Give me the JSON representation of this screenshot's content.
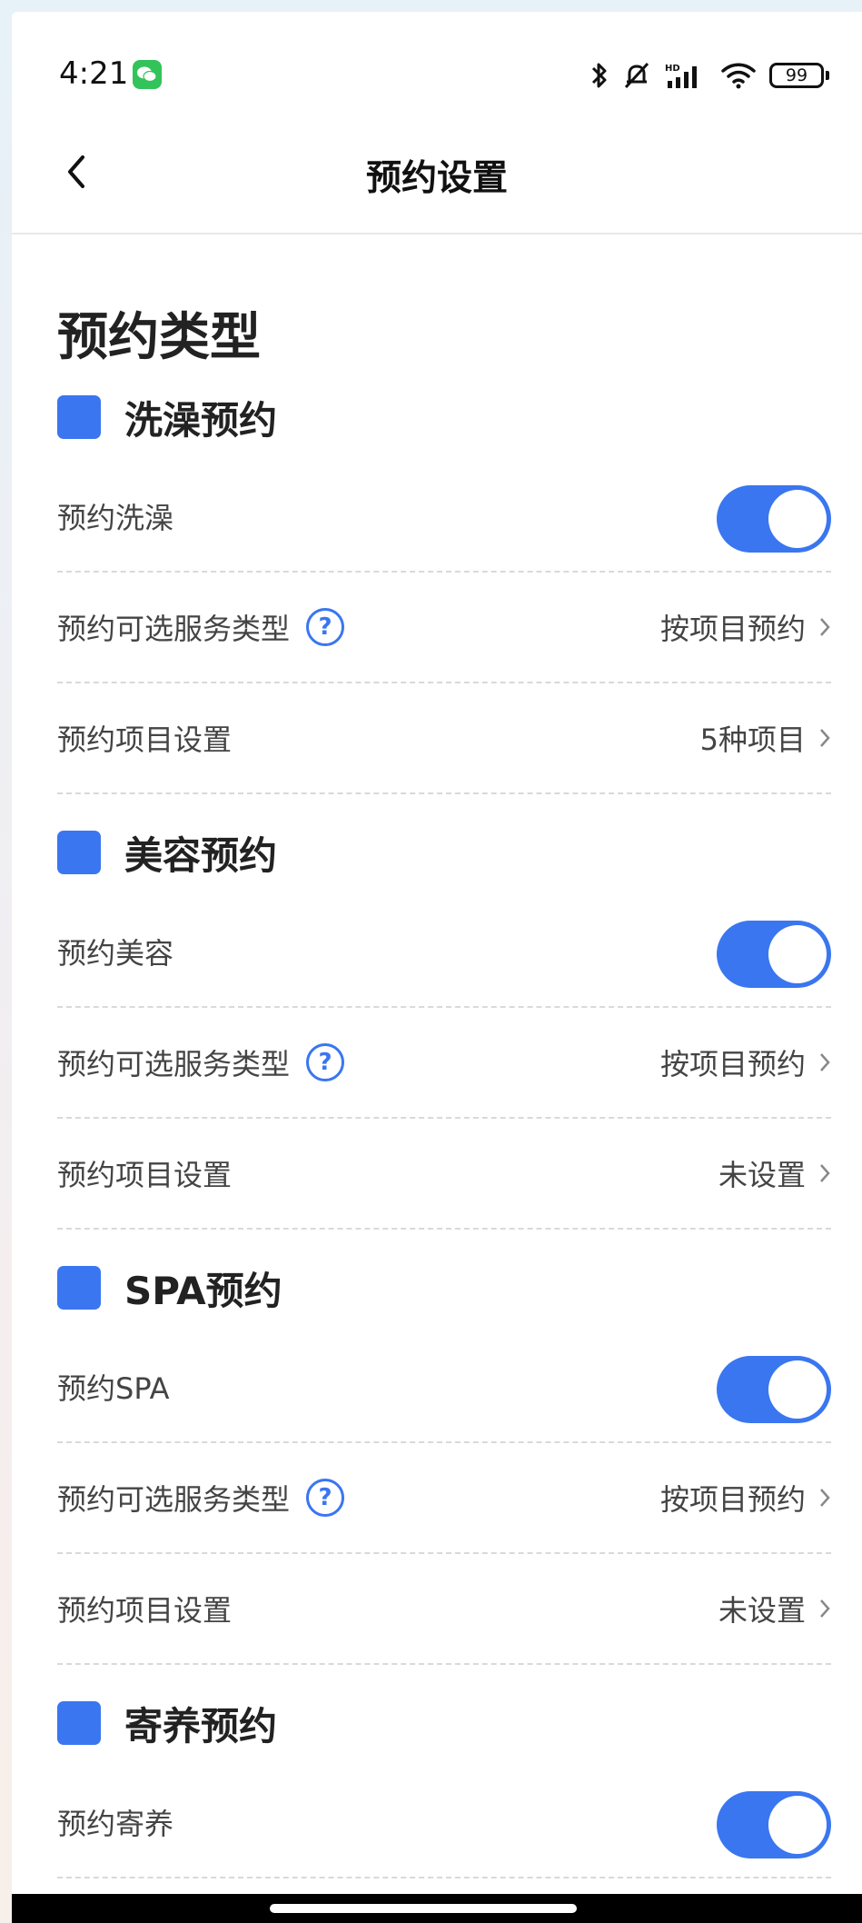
{
  "status_bar": {
    "time": "4:21",
    "battery": "99",
    "icons": [
      "wechat-icon",
      "bluetooth-icon",
      "bell-off-icon",
      "hd-signal-icon",
      "wifi-icon",
      "battery-icon"
    ]
  },
  "nav": {
    "title": "预约设置",
    "back_icon": "chevron-left-icon"
  },
  "page_heading": "预约类型",
  "accent_color": "#3a76f0",
  "sections": [
    {
      "title": "洗澡预约",
      "toggle_label": "预约洗澡",
      "toggle_on": true,
      "service_type_label": "预约可选服务类型",
      "service_type_value": "按项目预约",
      "items_label": "预约项目设置",
      "items_value": "5种项目"
    },
    {
      "title": "美容预约",
      "toggle_label": "预约美容",
      "toggle_on": true,
      "service_type_label": "预约可选服务类型",
      "service_type_value": "按项目预约",
      "items_label": "预约项目设置",
      "items_value": "未设置"
    },
    {
      "title": "SPA预约",
      "toggle_label": "预约SPA",
      "toggle_on": true,
      "service_type_label": "预约可选服务类型",
      "service_type_value": "按项目预约",
      "items_label": "预约项目设置",
      "items_value": "未设置"
    },
    {
      "title": "寄养预约",
      "toggle_label": "预约寄养",
      "toggle_on": true
    }
  ]
}
